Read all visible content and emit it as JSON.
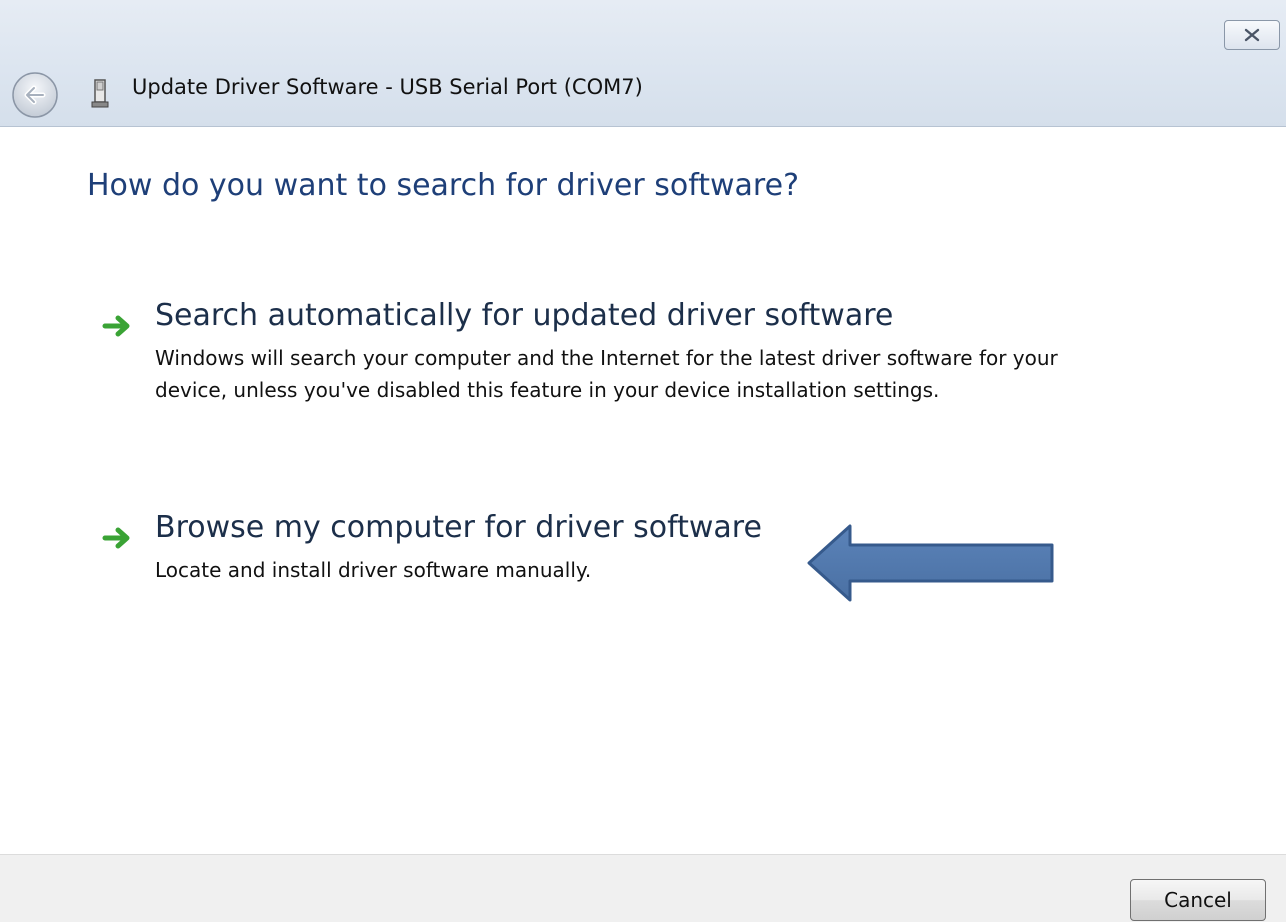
{
  "window": {
    "title": "Update Driver Software - USB Serial Port (COM7)",
    "back_icon": "back-arrow-icon",
    "device_icon": "usb-device-icon",
    "close_icon": "close-icon"
  },
  "main": {
    "heading": "How do you want to search for driver software?",
    "options": [
      {
        "icon": "green-arrow-icon",
        "title": "Search automatically for updated driver software",
        "description": "Windows will search your computer and the Internet for the latest driver software for your device, unless you've disabled this feature in your device installation settings."
      },
      {
        "icon": "green-arrow-icon",
        "title": "Browse my computer for driver software",
        "description": "Locate and install driver software manually."
      }
    ],
    "annotation_icon": "blue-pointer-arrow-icon"
  },
  "footer": {
    "cancel_label": "Cancel"
  },
  "colors": {
    "heading": "#1e3f78",
    "option_arrow": "#3aa335",
    "callout_arrow": "#4f77ad",
    "callout_arrow_border": "#365a8c"
  }
}
